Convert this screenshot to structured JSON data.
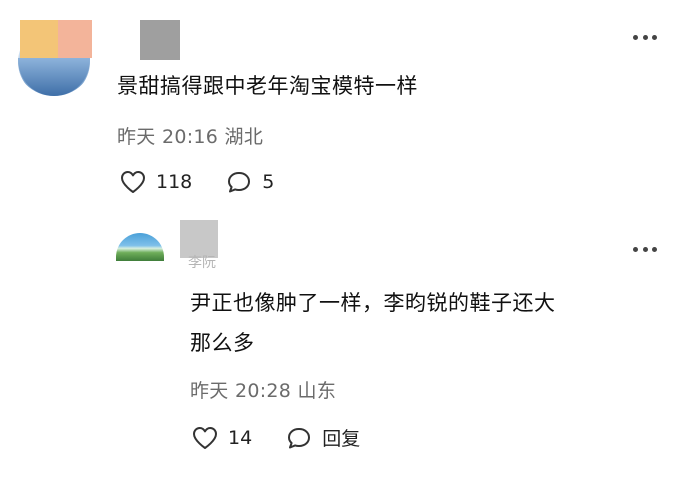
{
  "comment": {
    "text": "景甜搞得跟中老年淘宝模特一样",
    "time": "昨天 20:16",
    "location": "湖北",
    "likes": "118",
    "replies": "5"
  },
  "reply": {
    "name_fragment": "李阮",
    "text_line1": "尹正也像肿了一样，李昀锐的鞋子还大",
    "text_line2": "那么多",
    "time": "昨天 20:28",
    "location": "山东",
    "likes": "14",
    "reply_label": "回复"
  },
  "icons": {
    "like": "heart-outline-icon",
    "comment": "speech-bubble-icon",
    "more": "more-dots-icon"
  }
}
